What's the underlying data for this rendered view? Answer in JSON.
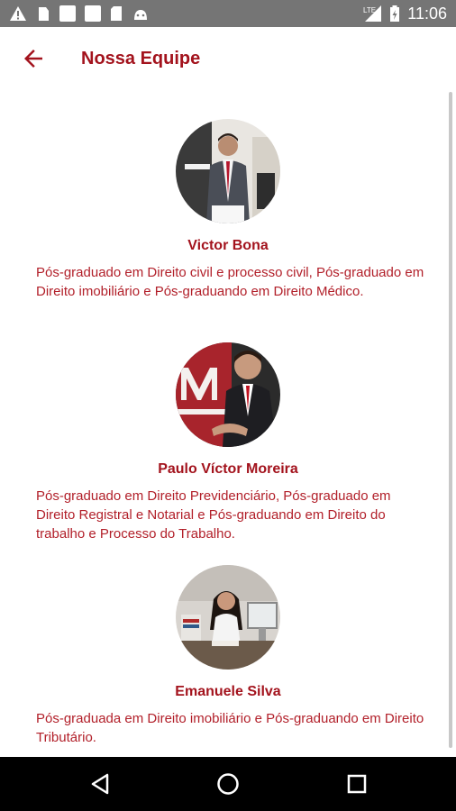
{
  "status_bar": {
    "time": "11:06",
    "icons": [
      "warning-icon",
      "notification-icon",
      "image-icon",
      "image-icon",
      "sd-card-icon",
      "android-icon",
      "lte-signal-icon",
      "battery-charging-icon"
    ]
  },
  "app_bar": {
    "title": "Nossa Equipe",
    "back_icon": "arrow-left-icon"
  },
  "colors": {
    "accent": "#a3131d",
    "text": "#b2202a",
    "status_bar": "#757575",
    "nav_bar": "#000000"
  },
  "team": [
    {
      "name": "Victor Bona",
      "description": "Pós-graduado em Direito civil e processo civil, Pós-graduado em Direito imobiliário e Pós-graduando em Direito Médico."
    },
    {
      "name": "Paulo Víctor Moreira",
      "description": "Pós-graduado em Direito Previdenciário, Pós-graduado em Direito Registral e Notarial e Pós-graduando em Direito do trabalho e Processo do Trabalho."
    },
    {
      "name": "Emanuele Silva",
      "description": "Pós-graduada em Direito imobiliário e Pós-graduando em Direito Tributário."
    }
  ],
  "nav_bar": {
    "icons": [
      "back-triangle-icon",
      "home-circle-icon",
      "recents-square-icon"
    ]
  }
}
